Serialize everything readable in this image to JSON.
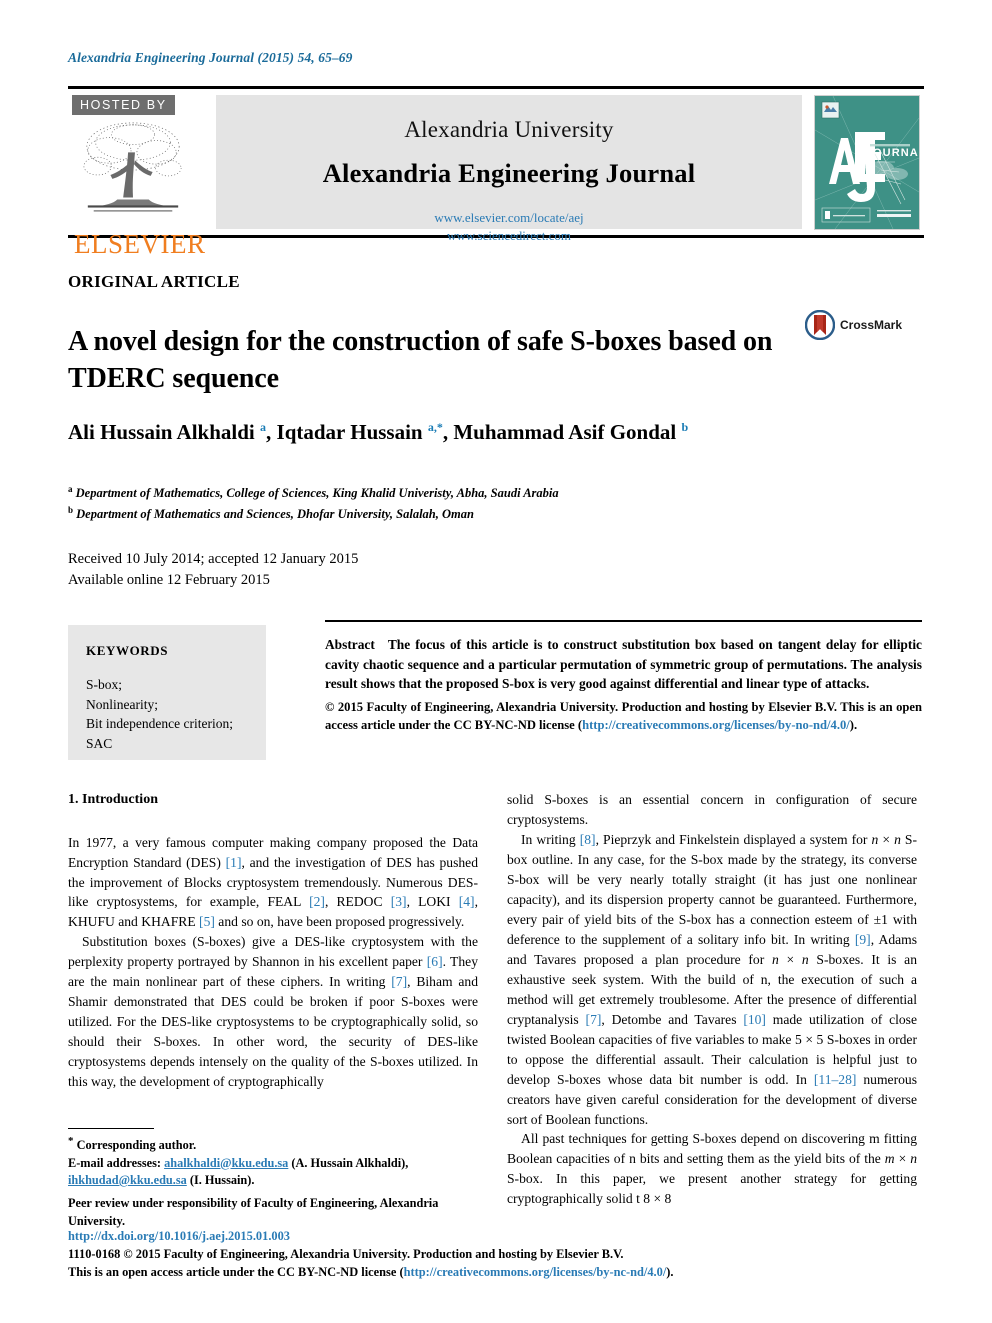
{
  "running_head": "Alexandria Engineering Journal (2015) 54, 65–69",
  "masthead": {
    "hosted_by": "HOSTED BY",
    "publisher": "ELSEVIER",
    "publisher_logo_icon": "elsevier-tree-icon",
    "university": "Alexandria University",
    "journal_title": "Alexandria Engineering Journal",
    "link_locate": "www.elsevier.com/locate/aej",
    "link_sciencedirect": "www.sciencedirect.com",
    "cover_letters": "AEJ",
    "cover_word": "JOURNAL",
    "cover_color": "#3e9186"
  },
  "article": {
    "kicker": "ORIGINAL ARTICLE",
    "title": "A novel design for the construction of safe S-boxes based on TDERC sequence",
    "crossmark_label": "CrossMark",
    "authors_html": "Ali Hussain Alkhaldi <sup>a</sup>, Iqtadar Hussain <sup>a,*</sup>, Muhammad Asif Gondal <sup>b</sup>",
    "affiliation_a": "Department of Mathematics, College of Sciences, King Khalid Univeristy, Abha, Saudi Arabia",
    "affiliation_b": "Department of Mathematics and Sciences, Dhofar University, Salalah, Oman",
    "received": "Received 10 July 2014; accepted 12 January 2015",
    "available": "Available online 12 February 2015"
  },
  "keywords": {
    "heading": "KEYWORDS",
    "items": [
      "S-box;",
      "Nonlinearity;",
      "Bit independence criterion;",
      "SAC"
    ]
  },
  "abstract": {
    "label": "Abstract",
    "text": "The focus of this article is to construct substitution box based on tangent delay for elliptic cavity chaotic sequence and a particular permutation of symmetric group of permutations. The analysis result shows that the proposed S-box is very good against differential and linear type of attacks.",
    "copyright": "© 2015 Faculty of Engineering, Alexandria University. Production and hosting by Elsevier B.V. This is an open access article under the CC BY-NC-ND license (",
    "license_link": "http://creativecommons.org/licenses/by-no-nd/4.0/",
    "copyright_tail": ")."
  },
  "body": {
    "section_heading": "1. Introduction",
    "left_p1": "In 1977, a very famous computer making company proposed the Data Encryption Standard (DES) [1], and the investigation of DES has pushed the improvement of Blocks cryptosystem tremendously. Numerous DES-like cryptosystems, for example, FEAL [2], REDOC [3], LOKI [4], KHUFU and KHAFRE [5] and so on, have been proposed progressively.",
    "left_p2": "Substitution boxes (S-boxes) give a DES-like cryptosystem with the perplexity property portrayed by Shannon in his excellent paper [6]. They are the main nonlinear part of these ciphers. In writing [7], Biham and Shamir demonstrated that DES could be broken if poor S-boxes were utilized. For the DES-like cryptosystems to be cryptographically solid, so should their S-boxes. In other word, the security of DES-like cryptosystems depends intensely on the quality of the S-boxes utilized. In this way, the development of cryptographically",
    "right_p1": "solid S-boxes is an essential concern in configuration of secure cryptosystems.",
    "right_p2": "In writing [8], Pieprzyk and Finkelstein displayed a system for n × n S-box outline. In any case, for the S-box made by the strategy, its converse S-box will be very nearly totally straight (it has just one nonlinear capacity), and its dispersion property cannot be guaranteed. Furthermore, every pair of yield bits of the S-box has a connection esteem of ±1 with deference to the supplement of a solitary info bit. In writing [9], Adams and Tavares proposed a plan procedure for n × n S-boxes. It is an exhaustive seek system. With the build of n, the execution of such a method will get extremely troublesome. After the presence of differential cryptanalysis [7], Detombe and Tavares [10] made utilization of close twisted Boolean capacities of five variables to make 5 × 5 S-boxes in order to oppose the differential assault. Their calculation is helpful just to develop S-boxes whose data bit number is odd. In [11–28] numerous creators have given careful consideration for the development of diverse sort of Boolean functions.",
    "right_p3": "All past techniques for getting S-boxes depend on discovering m fitting Boolean capacities of n bits and setting them as the yield bits of the m × n S-box. In this paper, we present another strategy for getting cryptographically solid t 8 × 8"
  },
  "footnotes": {
    "corresponding": "Corresponding author.",
    "email_label": "E-mail addresses:",
    "email1": "ahalkhaldi@kku.edu.sa",
    "email1_name": "(A. Hussain Alkhaldi),",
    "email2": "ihkhudad@kku.edu.sa",
    "email2_name": "(I. Hussain).",
    "peer_review": "Peer review under responsibility of Faculty of Engineering, Alexandria University."
  },
  "footer": {
    "doi": "http://dx.doi.org/10.1016/j.aej.2015.01.003",
    "issn_line": "1110-0168 © 2015 Faculty of Engineering, Alexandria University. Production and hosting by Elsevier B.V.",
    "license_pre": "This is an open access article under the CC BY-NC-ND license (",
    "license_link": "http://creativecommons.org/licenses/by-nc-nd/4.0/",
    "license_post": ")."
  },
  "colors": {
    "link": "#2a7bb5",
    "running_head": "#1a6b9a",
    "elsevier_orange": "#F07E20",
    "masthead_grey": "#e4e4e4",
    "keywords_grey": "#e7e7e7"
  }
}
